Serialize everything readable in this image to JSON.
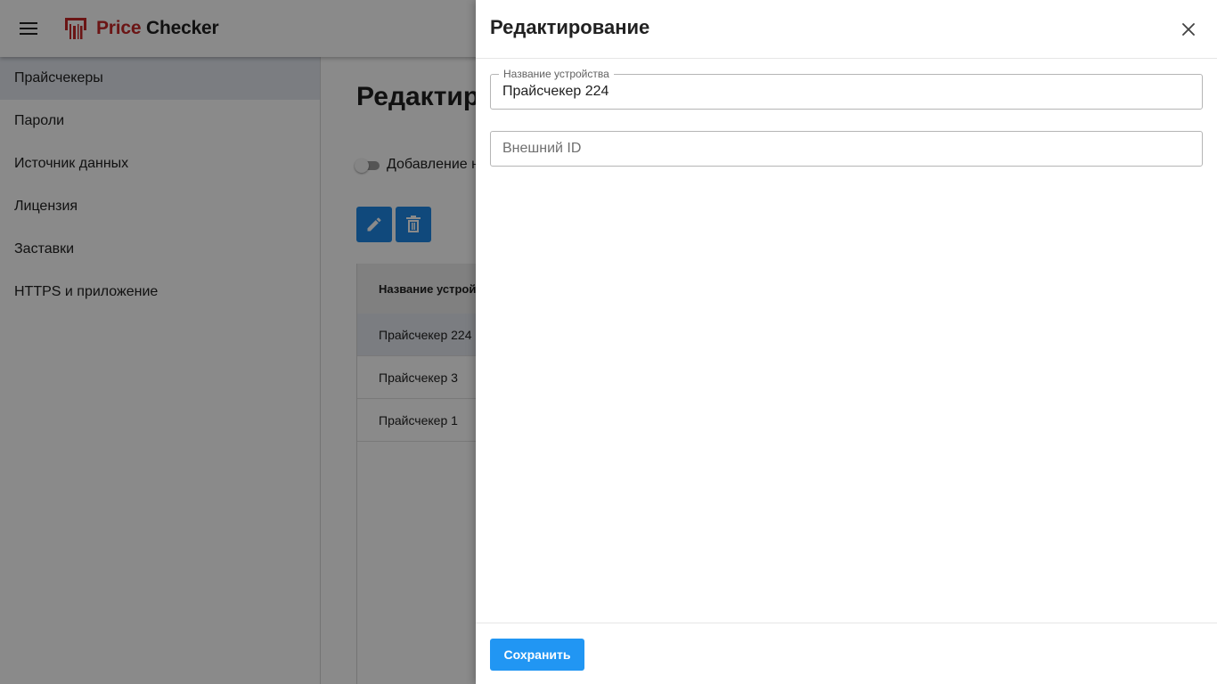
{
  "header": {
    "logo_price": "Price",
    "logo_checker": "Checker"
  },
  "sidebar": {
    "items": [
      {
        "label": "Прайсчекеры",
        "active": true
      },
      {
        "label": "Пароли"
      },
      {
        "label": "Источник данных"
      },
      {
        "label": "Лицензия"
      },
      {
        "label": "Заставки"
      },
      {
        "label": "HTTPS и приложение"
      }
    ]
  },
  "main": {
    "title": "Редактир",
    "switch_label": "Добавление н",
    "table": {
      "header": "Название устройс",
      "rows": [
        "Прайсчекер 224",
        "Прайсчекер 3",
        "Прайсчекер 1"
      ]
    }
  },
  "dialog": {
    "title": "Редактирование",
    "fields": {
      "name": {
        "legend": "Название устройства",
        "value": "Прайсчекер 224"
      },
      "external_id": {
        "placeholder": "Внешний ID",
        "value": ""
      }
    },
    "save_label": "Сохранить"
  },
  "colors": {
    "brand_red": "#c62828",
    "primary_blue": "#2196f3",
    "action_blue": "#1e88e5",
    "selected_row": "#e3e7ef"
  },
  "icons": {
    "menu": "hamburger-icon",
    "logo": "barcode-scanner-icon",
    "edit": "pencil-icon",
    "delete": "trash-icon",
    "close": "close-icon"
  }
}
